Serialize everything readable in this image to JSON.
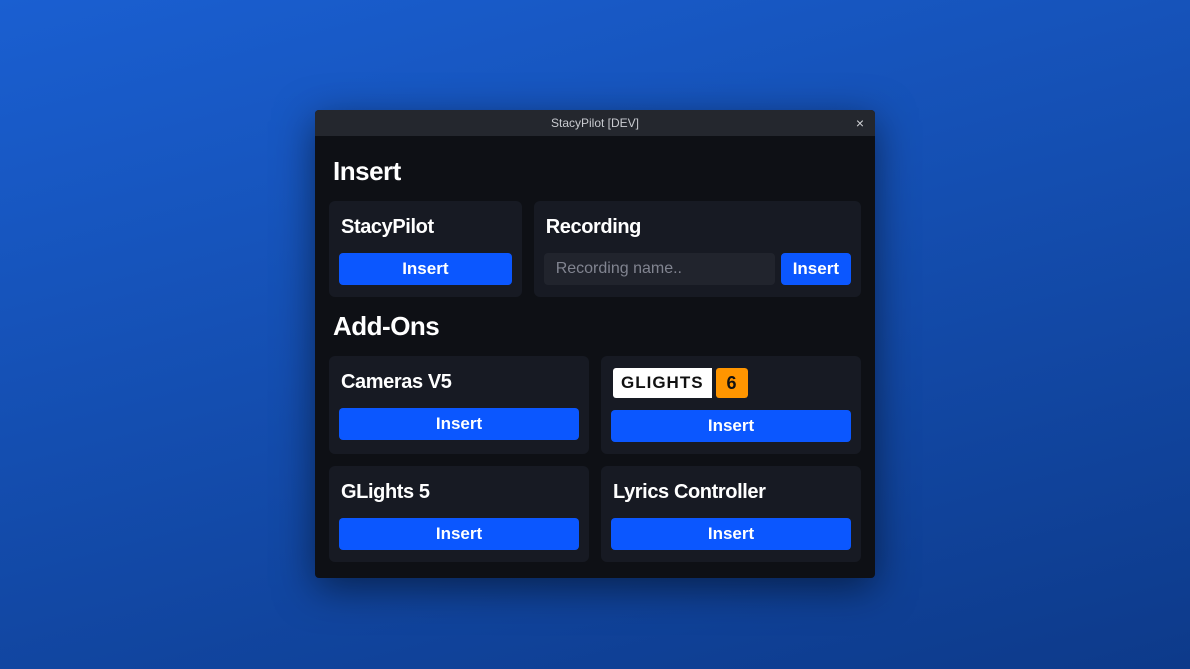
{
  "window": {
    "title": "StacyPilot [DEV]"
  },
  "sections": {
    "insert_title": "Insert",
    "addons_title": "Add-Ons"
  },
  "cards": {
    "stacypilot": {
      "title": "StacyPilot",
      "button": "Insert"
    },
    "recording": {
      "title": "Recording",
      "placeholder": "Recording name..",
      "button": "Insert"
    },
    "cameras": {
      "title": "Cameras V5",
      "button": "Insert"
    },
    "glights6": {
      "logo_word": "GLIGHTS",
      "logo_num": "6",
      "button": "Insert"
    },
    "glights5": {
      "title": "GLights 5",
      "button": "Insert"
    },
    "lyrics": {
      "title": "Lyrics Controller",
      "button": "Insert"
    }
  },
  "colors": {
    "accent": "#0b57ff",
    "card_bg": "#171a23",
    "window_bg": "#0e1015",
    "glights_orange": "#ff9500"
  }
}
